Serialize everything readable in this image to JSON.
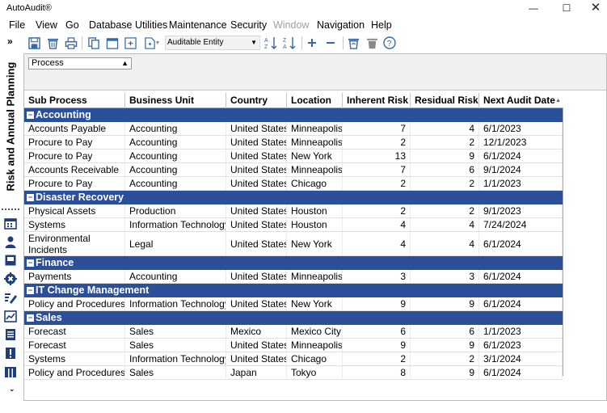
{
  "window": {
    "title": "AutoAudit®",
    "controls": {
      "minimize": "—",
      "maximize": "☐",
      "close": "✕"
    }
  },
  "menu": [
    "File",
    "View",
    "Go",
    "Database Utilities",
    "Maintenance",
    "Security",
    "Window",
    "Navigation",
    "Help"
  ],
  "menu_disabled": [
    "Window"
  ],
  "rail": {
    "title": "Risk and Annual Planning",
    "icons": [
      "calendar-grid-icon",
      "person-icon",
      "book-icon",
      "gear-icon",
      "edit-list-icon",
      "planner-icon",
      "document-icon",
      "alert-icon",
      "columns-icon"
    ]
  },
  "toolbar": {
    "icons": [
      "save-icon",
      "delete-icon",
      "print-icon",
      "copy-icon",
      "calendar-icon",
      "export-icon",
      "new-document-icon",
      "sort-ascending-icon",
      "sort-descending-icon",
      "add-icon",
      "remove-icon",
      "recycle-icon",
      "trash-icon",
      "help-icon"
    ],
    "entity_select": "Auditable Entity"
  },
  "group_panel": {
    "chip": "Process"
  },
  "grid": {
    "columns": [
      "Sub Process",
      "Business Unit",
      "Country",
      "Location",
      "Inherent Risk",
      "Residual Risk",
      "Next Audit Date"
    ],
    "groups": [
      {
        "name": "Accounting",
        "rows": [
          [
            "Accounts Payable",
            "Accounting",
            "United States",
            "Minneapolis",
            "7",
            "4",
            "6/1/2023"
          ],
          [
            "Procure to Pay",
            "Accounting",
            "United States",
            "Minneapolis",
            "2",
            "2",
            "12/1/2023"
          ],
          [
            "Procure to Pay",
            "Accounting",
            "United States",
            "New York",
            "13",
            "9",
            "6/1/2024"
          ],
          [
            "Accounts Receivable",
            "Accounting",
            "United States",
            "Minneapolis",
            "7",
            "6",
            "9/1/2024"
          ],
          [
            "Procure to Pay",
            "Accounting",
            "United States",
            "Chicago",
            "2",
            "2",
            "1/1/2023"
          ]
        ]
      },
      {
        "name": "Disaster Recovery",
        "rows": [
          [
            "Physical Assets",
            "Production",
            "United States",
            "Houston",
            "2",
            "2",
            "9/1/2023"
          ],
          [
            "Systems",
            "Information Technology",
            "United States",
            "Houston",
            "4",
            "4",
            "7/24/2024"
          ],
          [
            "Environmental Incidents",
            "Legal",
            "United States",
            "New York",
            "4",
            "4",
            "6/1/2024"
          ]
        ]
      },
      {
        "name": "Finance",
        "rows": [
          [
            "Payments",
            "Accounting",
            "United States",
            "Minneapolis",
            "3",
            "3",
            "6/1/2024"
          ]
        ]
      },
      {
        "name": "IT Change Management",
        "rows": [
          [
            "Policy and Procedures",
            "Information Technology",
            "United States",
            "New York",
            "9",
            "9",
            "6/1/2024"
          ]
        ]
      },
      {
        "name": "Sales",
        "rows": [
          [
            "Forecast",
            "Sales",
            "Mexico",
            "Mexico City",
            "6",
            "6",
            "1/1/2023"
          ],
          [
            "Forecast",
            "Sales",
            "United States",
            "Minneapolis",
            "9",
            "9",
            "6/1/2023"
          ],
          [
            "Systems",
            "Information Technology",
            "United States",
            "Chicago",
            "2",
            "2",
            "3/1/2024"
          ],
          [
            "Policy and Procedures",
            "Sales",
            "Japan",
            "Tokyo",
            "8",
            "9",
            "6/1/2024"
          ]
        ]
      }
    ]
  },
  "colors": {
    "group_band": "#2c4f9a",
    "icon_blue": "#3568a8",
    "rail_blue": "#1f3f7a"
  }
}
